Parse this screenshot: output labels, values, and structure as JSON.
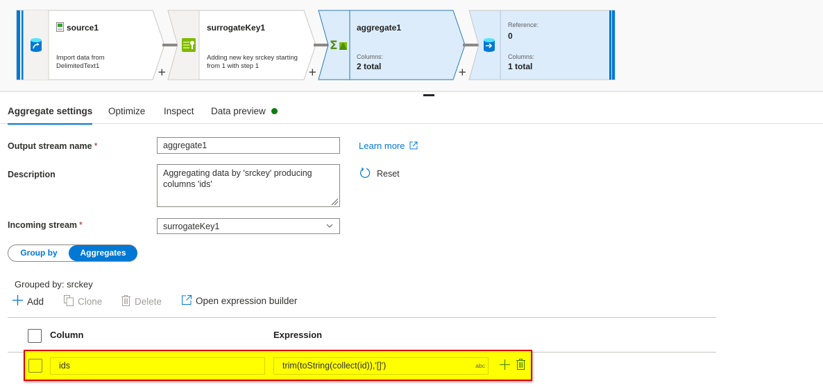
{
  "pipeline": {
    "nodes": [
      {
        "id": "source1",
        "title": "source1",
        "description_line1": "Import data from",
        "description_line2": "DelimitedText1",
        "icon": "source-database-icon",
        "title_icon": "csv-file-icon"
      },
      {
        "id": "surrogateKey1",
        "title": "surrogateKey1",
        "description_line1": "Adding new key srckey starting",
        "description_line2": "from 1 with step 1",
        "icon": "surrogate-key-icon"
      },
      {
        "id": "aggregate1",
        "title": "aggregate1",
        "columns_label": "Columns:",
        "columns_value": "2 total",
        "icon": "aggregate-sigma-icon",
        "selected": true
      },
      {
        "id": "sink",
        "reference_label": "Reference:",
        "reference_value": "0",
        "columns_label": "Columns:",
        "columns_value": "1 total",
        "icon": "sink-database-icon"
      }
    ],
    "add_symbol": "+"
  },
  "tabs": [
    {
      "label": "Aggregate settings",
      "active": true
    },
    {
      "label": "Optimize",
      "active": false
    },
    {
      "label": "Inspect",
      "active": false
    },
    {
      "label": "Data preview",
      "active": false,
      "status": "green-dot"
    }
  ],
  "form": {
    "output_stream_label": "Output stream name",
    "output_stream_value": "aggregate1",
    "description_label": "Description",
    "description_value": "Aggregating data by 'srckey' producing columns 'ids'",
    "incoming_stream_label": "Incoming stream",
    "incoming_stream_value": "surrogateKey1",
    "required_marker": "*",
    "learn_more": "Learn more",
    "reset": "Reset"
  },
  "toggle": {
    "options": [
      "Group by",
      "Aggregates"
    ],
    "selected": "Aggregates"
  },
  "grouped_by": "Grouped by: srckey",
  "toolbar": {
    "add": "Add",
    "clone": "Clone",
    "delete": "Delete",
    "open_expression_builder": "Open expression builder"
  },
  "table": {
    "headers": {
      "column": "Column",
      "expression": "Expression"
    },
    "rows": [
      {
        "column": "ids",
        "expression": "trim(toString(collect(id)),'[]')",
        "type_badge": "abc"
      }
    ]
  },
  "colors": {
    "accent": "#0078d4",
    "highlight": "#ffff00",
    "highlight_border": "#e00000",
    "status_green": "#107c10",
    "selected_node": "#dcecfb"
  }
}
